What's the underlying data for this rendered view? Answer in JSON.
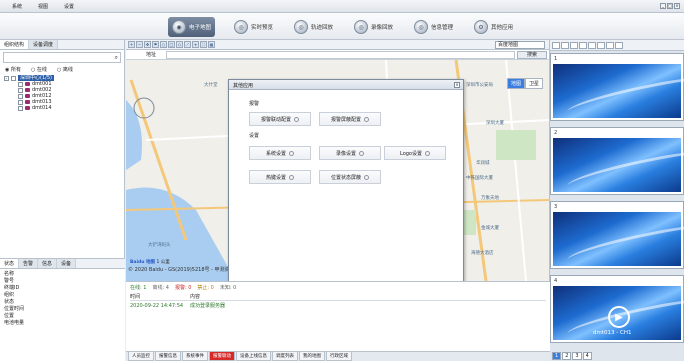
{
  "menubar": {
    "items": [
      "系统",
      "视图",
      "设置"
    ]
  },
  "nav": {
    "items": [
      {
        "label": "电子地图",
        "active": true
      },
      {
        "label": "实时预览",
        "active": false
      },
      {
        "label": "轨迹回放",
        "active": false
      },
      {
        "label": "录像回放",
        "active": false
      },
      {
        "label": "信息管理",
        "active": false
      },
      {
        "label": "其他应用",
        "active": false
      }
    ]
  },
  "left": {
    "tabs": [
      "组织结构",
      "设备调度"
    ],
    "filters": [
      "所有",
      "在线",
      "离线"
    ],
    "tree": {
      "root": "深圳中心(1/5)",
      "devices": [
        "dmt001",
        "dmt002",
        "dmt012",
        "dmt013",
        "dmt014"
      ]
    },
    "bottom_tabs": [
      "状态",
      "告警",
      "信息",
      "设备"
    ],
    "info_fields": [
      "名称",
      "警号",
      "终端ID",
      "组织",
      "状态",
      "位置时间",
      "位置",
      "电池电量"
    ]
  },
  "map": {
    "address_label": "地址",
    "search_button": "搜索",
    "source_select": "百度地图",
    "types": [
      "地图",
      "卫星"
    ],
    "scale": "1 公里",
    "copyright": "© 2020 Baidu - GS(2019)5218号 - 甲测资字",
    "baidu_brand": "Baidu 地图",
    "labels": [
      "大什堂",
      "深圳市公安局",
      "深圳大厦",
      "华润城",
      "中铁国际大厦",
      "万象天地",
      "金城大厦",
      "大铲湾码头",
      "海德大酒店"
    ]
  },
  "dialog": {
    "title": "其他应用",
    "section_alarm": "报警",
    "alarm_buttons": [
      "报警联动配置",
      "报警屏蔽配置"
    ],
    "section_settings": "设置",
    "settings_buttons": [
      "系统设置",
      "录像设置",
      "Logo设置",
      "热键设置",
      "位置状态屏蔽"
    ]
  },
  "events": {
    "status": [
      "在线: 1",
      "离线: 4",
      "报警: 0",
      "禁止: 0",
      "未知: 0"
    ],
    "columns": [
      "时间",
      "内容"
    ],
    "rows": [
      {
        "time": "2020-09-22 14:47:54",
        "content": "成功登录服务器"
      }
    ]
  },
  "bottom_tabs": [
    {
      "label": "人员监控",
      "active": false
    },
    {
      "label": "报警信息",
      "active": false
    },
    {
      "label": "系统事件",
      "active": false
    },
    {
      "label": "报警联动",
      "active": true
    },
    {
      "label": "设备上线信息",
      "active": false
    },
    {
      "label": "调度列表",
      "active": false
    },
    {
      "label": "我的地图",
      "active": false
    },
    {
      "label": "行政区域",
      "active": false
    }
  ],
  "video": {
    "tiles": [
      {
        "num": "1",
        "label": ""
      },
      {
        "num": "2",
        "label": ""
      },
      {
        "num": "3",
        "label": ""
      },
      {
        "num": "4",
        "label": "dmt013 - CH1"
      }
    ],
    "pages": [
      "1",
      "2",
      "3",
      "4"
    ]
  },
  "colors": {
    "nav_active": "#5a6b84",
    "tab_active": "#d62a2a",
    "accent": "#3b7de0"
  }
}
